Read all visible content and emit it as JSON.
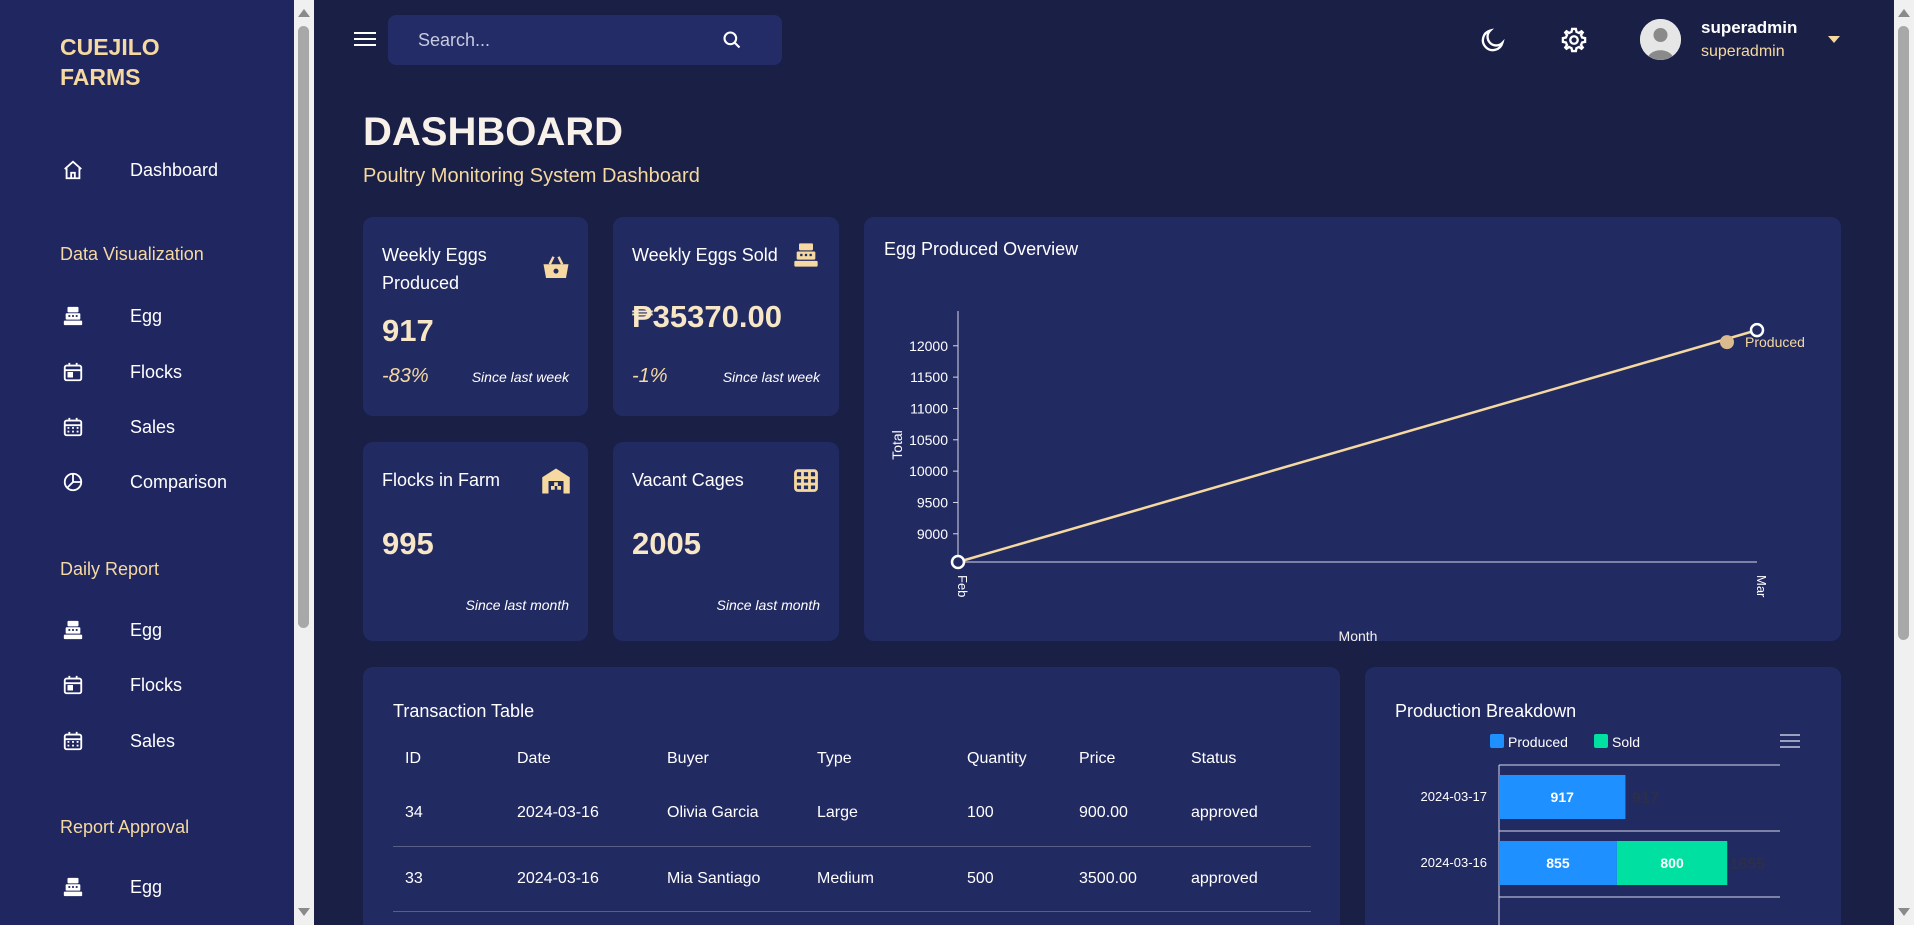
{
  "sidebar": {
    "brand": "CUEJILO FARMS",
    "dashboard": "Dashboard",
    "sections": {
      "data_visualization": "Data Visualization",
      "daily_report": "Daily Report",
      "report_approval": "Report Approval"
    },
    "data_visualization_items": [
      "Egg",
      "Flocks",
      "Sales",
      "Comparison"
    ],
    "daily_report_items": [
      "Egg",
      "Flocks",
      "Sales"
    ],
    "report_approval_items": [
      "Egg"
    ]
  },
  "topbar": {
    "search_placeholder": "Search...",
    "user_name": "superadmin",
    "user_role": "superadmin"
  },
  "header": {
    "title": "DASHBOARD",
    "subtitle": "Poultry Monitoring System Dashboard"
  },
  "stats": {
    "eggs_produced": {
      "title": "Weekly Eggs Produced",
      "value": "917",
      "pct": "-83%",
      "since": "Since last week"
    },
    "eggs_sold": {
      "title": "Weekly Eggs Sold",
      "value": "₱35370.00",
      "pct": "-1%",
      "since": "Since last week"
    },
    "flocks": {
      "title": "Flocks in Farm",
      "value": "995",
      "since": "Since last month"
    },
    "cages": {
      "title": "Vacant Cages",
      "value": "2005",
      "since": "Since last month"
    }
  },
  "colors": {
    "accent": "#f5d9a0",
    "card": "#222a62",
    "produced": "#1e90ff",
    "sold": "#00e0a0"
  },
  "chart_data": [
    {
      "type": "line",
      "title": "Egg Produced Overview",
      "xlabel": "Month",
      "ylabel": "Total",
      "x": [
        "Feb",
        "Mar"
      ],
      "yticks": [
        9000,
        9500,
        10000,
        10500,
        11000,
        11500,
        12000
      ],
      "ylim": [
        8550,
        12300
      ],
      "series": [
        {
          "name": "Produced",
          "values": [
            8550,
            12250
          ]
        }
      ],
      "legend": "inline-right"
    },
    {
      "type": "bar",
      "orientation": "horizontal-stacked",
      "title": "Production Breakdown",
      "categories": [
        "2024-03-17",
        "2024-03-16"
      ],
      "series": [
        {
          "name": "Produced",
          "values": [
            917,
            855
          ]
        },
        {
          "name": "Sold",
          "values": [
            0,
            800
          ]
        }
      ],
      "totals": [
        "917",
        "1655"
      ],
      "legend": "top"
    }
  ],
  "transactions": {
    "title": "Transaction Table",
    "columns": [
      "ID",
      "Date",
      "Buyer",
      "Type",
      "Quantity",
      "Price",
      "Status"
    ],
    "rows": [
      [
        "34",
        "2024-03-16",
        "Olivia Garcia",
        "Large",
        "100",
        "900.00",
        "approved"
      ],
      [
        "33",
        "2024-03-16",
        "Mia Santiago",
        "Medium",
        "500",
        "3500.00",
        "approved"
      ]
    ]
  }
}
